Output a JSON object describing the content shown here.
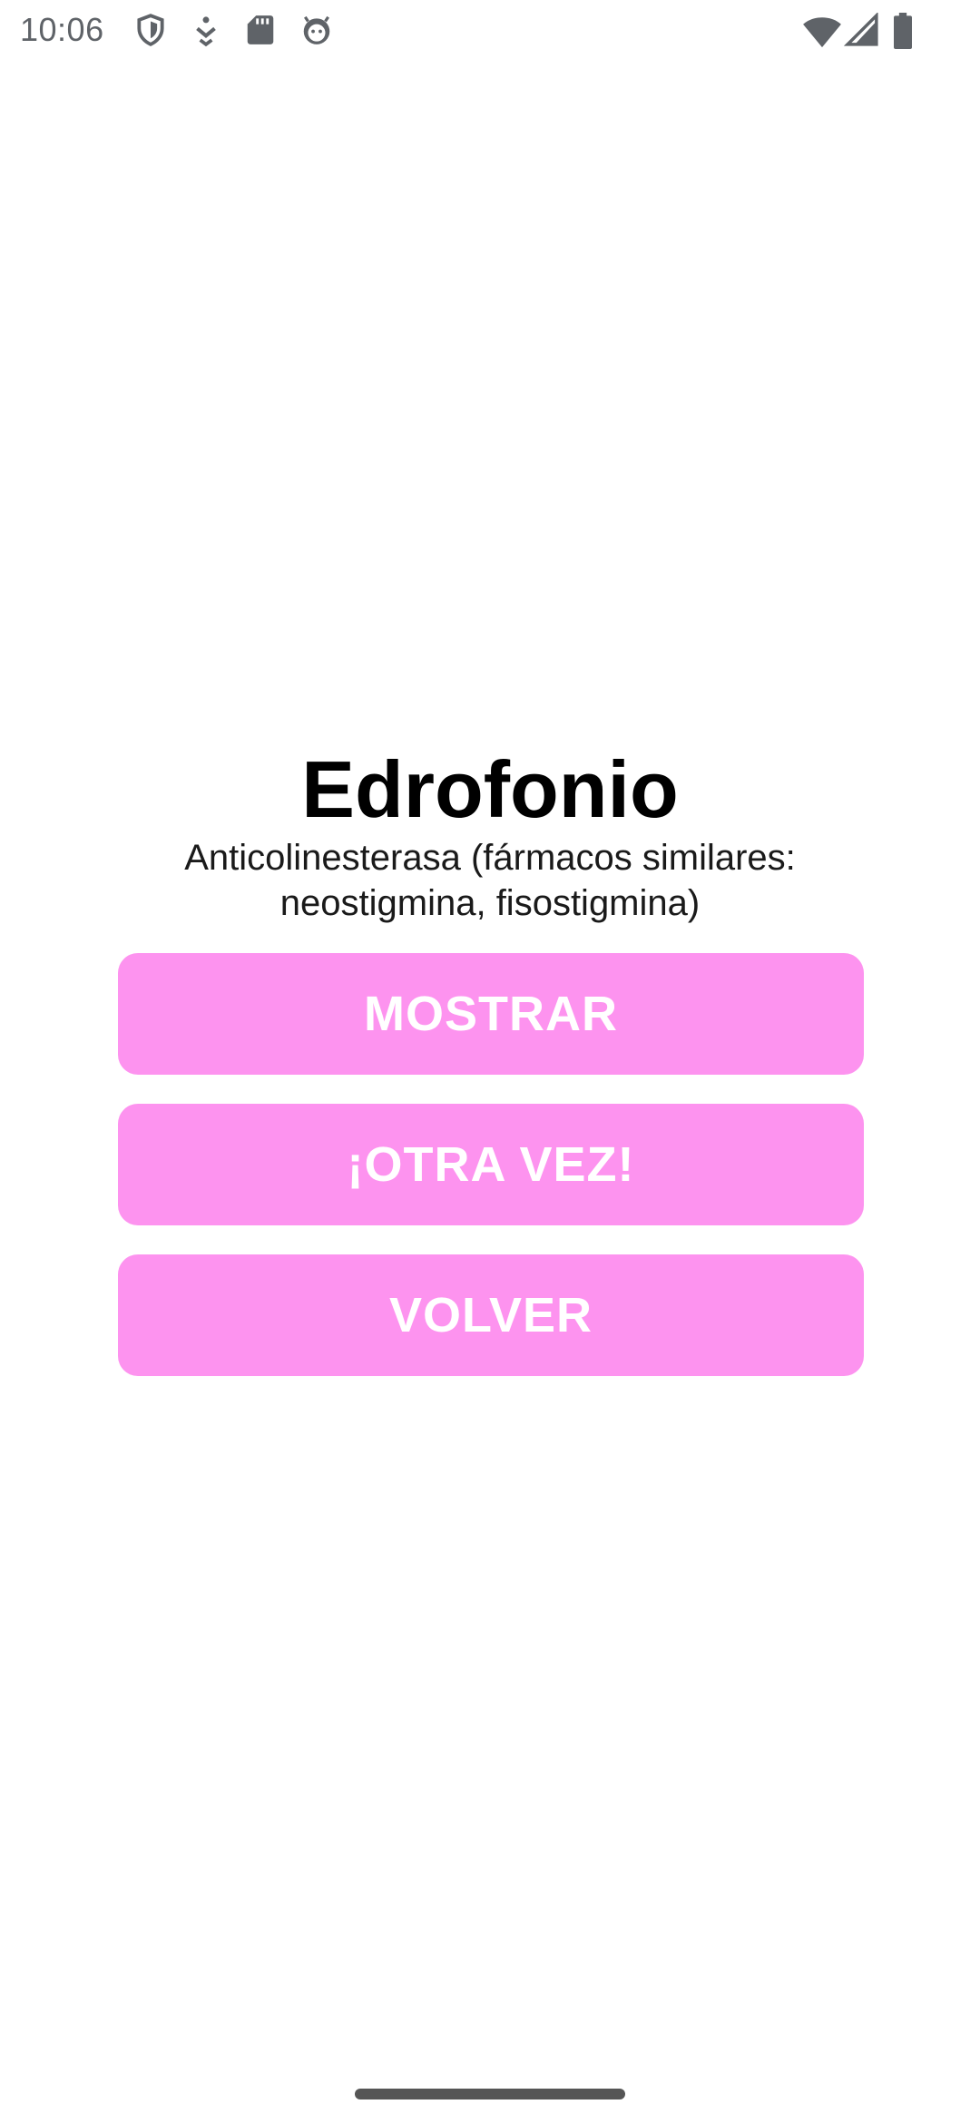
{
  "status_bar": {
    "time": "10:06",
    "left_icons": [
      "shield-icon",
      "download-arrow-icon",
      "sd-card-icon",
      "face-icon"
    ],
    "right_icons": [
      "wifi-icon",
      "cell-signal-icon",
      "battery-icon"
    ]
  },
  "card": {
    "title": "Edrofonio",
    "subtitle_line1": "Anticolinesterasa (fármacos similares:",
    "subtitle_line2": "neostigmina, fisostigmina)"
  },
  "buttons": {
    "show_label": "MOSTRAR",
    "again_label": "¡OTRA VEZ!",
    "back_label": "VOLVER"
  },
  "colors": {
    "button_background": "#fd93ef",
    "button_text": "#ffffff",
    "title": "#000000",
    "status_icons": "#5f6368"
  }
}
